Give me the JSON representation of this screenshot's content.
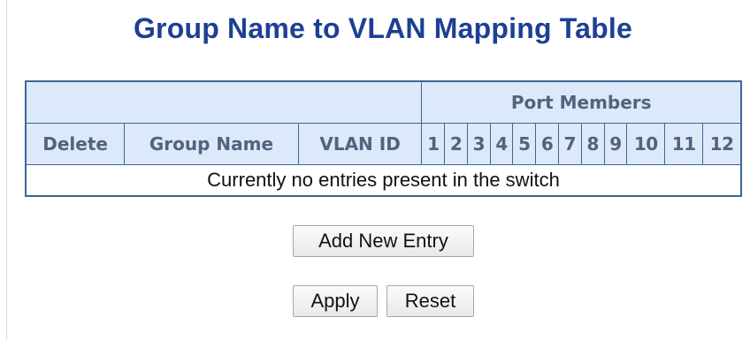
{
  "title": "Group Name to VLAN Mapping Table",
  "table": {
    "group_header": "Port Members",
    "columns": {
      "delete": "Delete",
      "group_name": "Group Name",
      "vlan_id": "VLAN ID"
    },
    "ports": [
      "1",
      "2",
      "3",
      "4",
      "5",
      "6",
      "7",
      "8",
      "9",
      "10",
      "11",
      "12"
    ],
    "empty_message": "Currently no entries present in the switch"
  },
  "buttons": {
    "add_new_entry": "Add New Entry",
    "apply": "Apply",
    "reset": "Reset"
  },
  "colors": {
    "title": "#1d3f94",
    "header_bg": "#dce9fa",
    "header_text": "#53637e",
    "border": "#3c6796"
  }
}
